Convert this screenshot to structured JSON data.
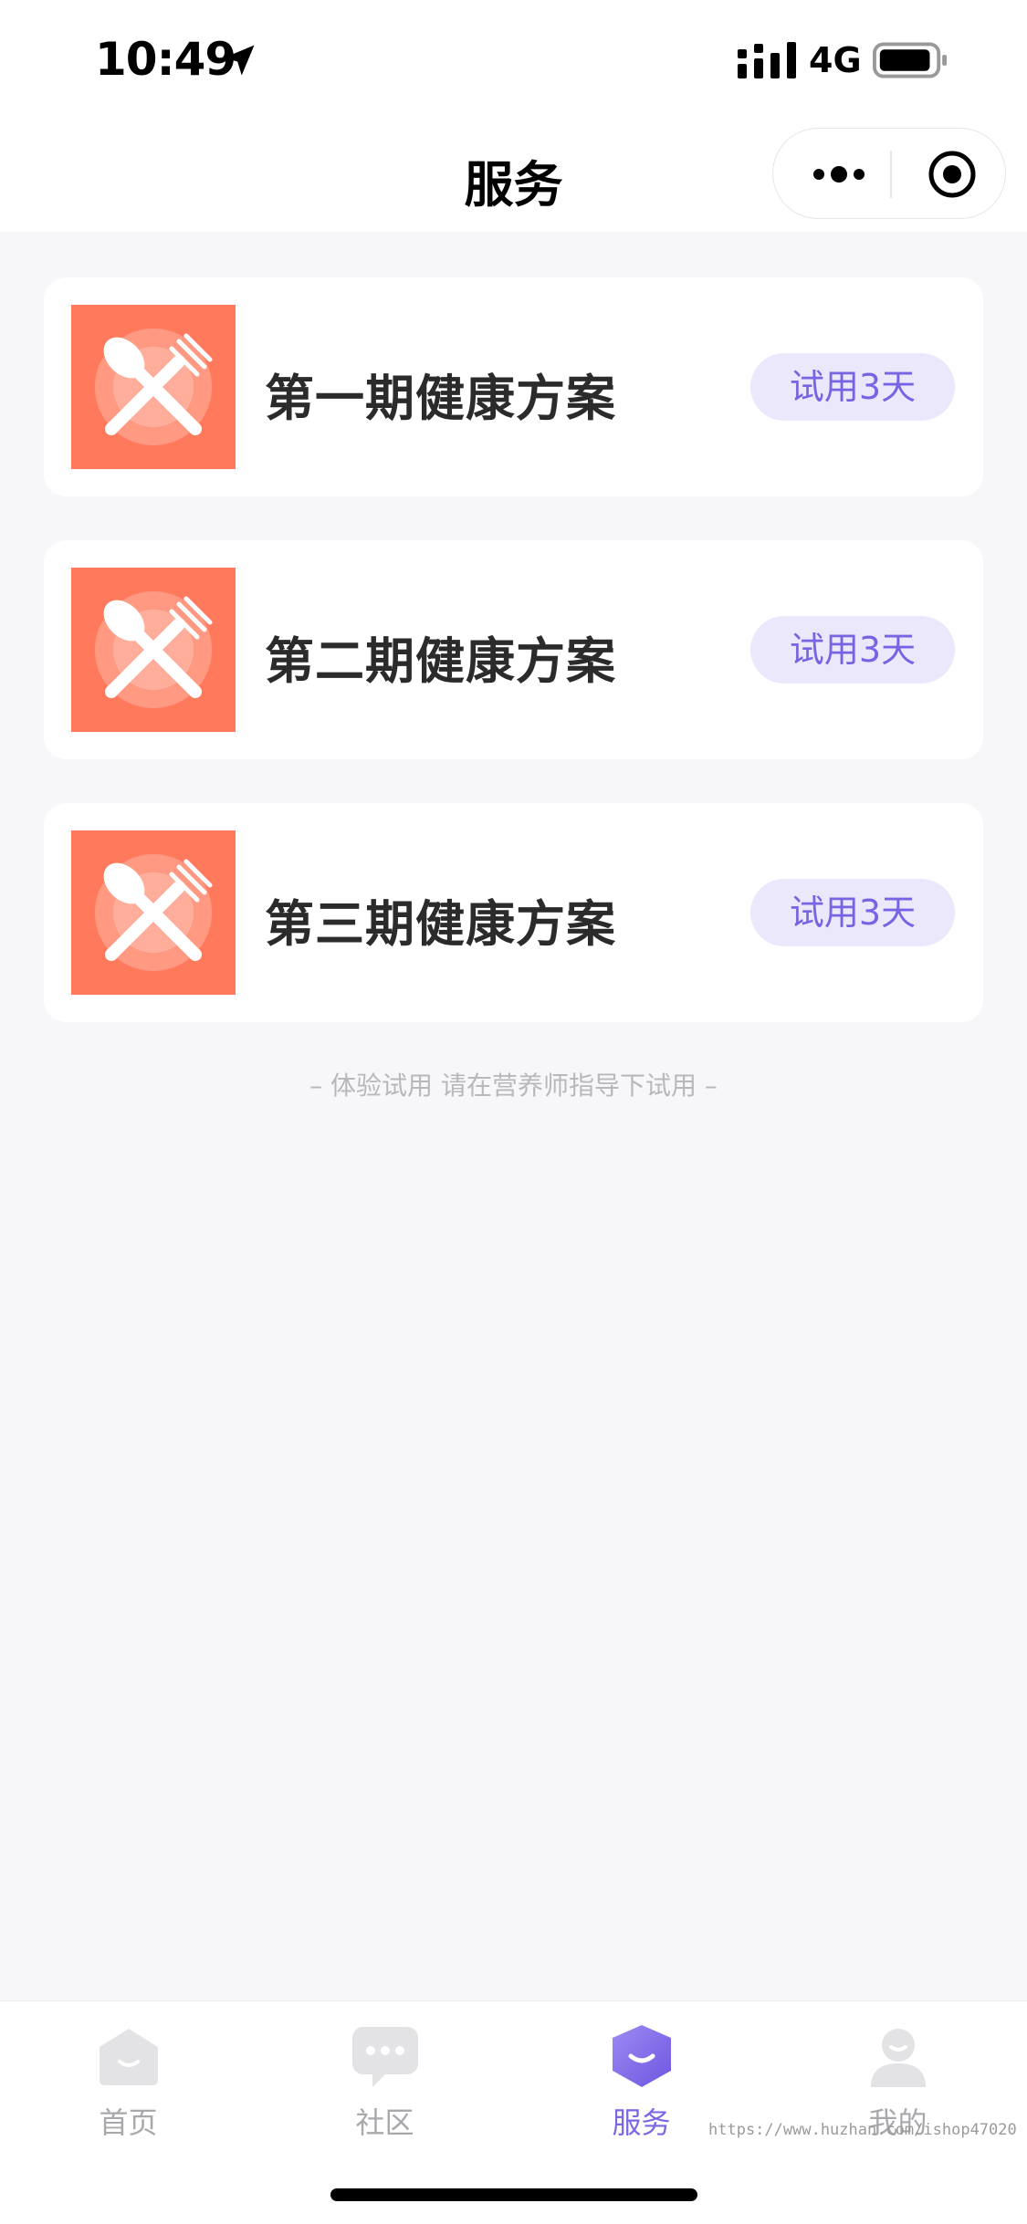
{
  "status_bar": {
    "time": "10:49",
    "network": "4G"
  },
  "nav": {
    "title": "服务"
  },
  "plans": [
    {
      "title": "第一期健康方案",
      "badge": "试用3天"
    },
    {
      "title": "第二期健康方案",
      "badge": "试用3天"
    },
    {
      "title": "第三期健康方案",
      "badge": "试用3天"
    }
  ],
  "hint": "– 体验试用 请在营养师指导下试用 –",
  "tabs": [
    {
      "label": "首页",
      "icon": "home-icon"
    },
    {
      "label": "社区",
      "icon": "chat-icon"
    },
    {
      "label": "服务",
      "icon": "service-icon",
      "active": true
    },
    {
      "label": "我的",
      "icon": "profile-icon"
    }
  ],
  "watermark": "https://www.huzhan.com/ishop47020",
  "colors": {
    "accent": "#7b66e6",
    "badge_bg": "#ebe8fb",
    "thumb": "#ff7a5c"
  }
}
